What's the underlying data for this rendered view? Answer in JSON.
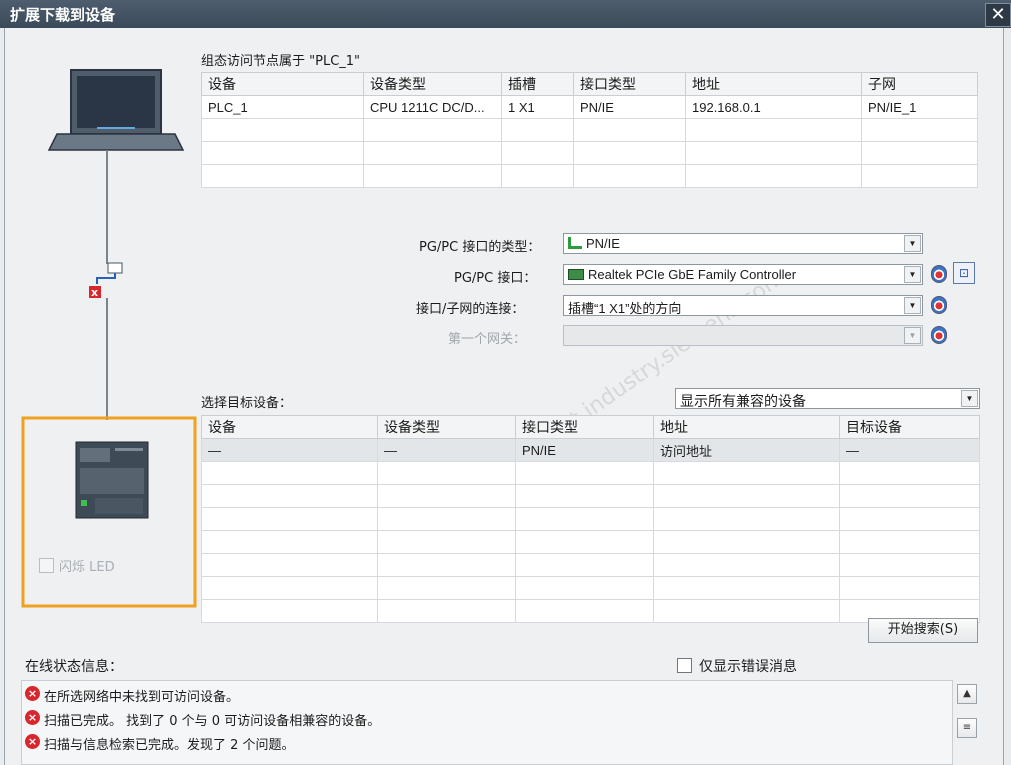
{
  "window": {
    "title": "扩展下载到设备",
    "close_glyph": "✕"
  },
  "config_section": {
    "heading": "组态访问节点属于 \"PLC_1\"",
    "columns": [
      "设备",
      "设备类型",
      "插槽",
      "接口类型",
      "地址",
      "子网"
    ],
    "rows": [
      [
        "PLC_1",
        "CPU 1211C DC/D...",
        "1 X1",
        "PN/IE",
        "192.168.0.1",
        "PN/IE_1"
      ]
    ]
  },
  "interface": {
    "type_label": "PG/PC 接口的类型：",
    "type_value": "PN/IE",
    "iface_label": "PG/PC 接口：",
    "iface_value": "Realtek PCIe GbE Family Controller",
    "conn_label": "接口/子网的连接：",
    "conn_value": "插槽“1 X1”处的方向",
    "gateway_label": "第一个网关：",
    "gateway_value": ""
  },
  "target_section": {
    "heading": "选择目标设备：",
    "filter_value": "显示所有兼容的设备",
    "columns": [
      "设备",
      "设备类型",
      "接口类型",
      "地址",
      "目标设备"
    ],
    "rows": [
      [
        "—",
        "—",
        "PN/IE",
        "访问地址",
        "—"
      ]
    ]
  },
  "flash_led_label": "闪烁 LED",
  "search_button": "开始搜索(S)",
  "status": {
    "heading": "在线状态信息：",
    "errors_only_label": "仅显示错误消息",
    "messages": [
      "在所选网络中未找到可访问设备。",
      "扫描已完成。 找到了 0 个与 0 可访问设备相兼容的设备。",
      "扫描与信息检索已完成。发现了 2 个问题。"
    ]
  },
  "colors": {
    "accent_orange": "#f0a11e",
    "error_red": "#d8262d",
    "titlebar": "#3b4a59"
  }
}
